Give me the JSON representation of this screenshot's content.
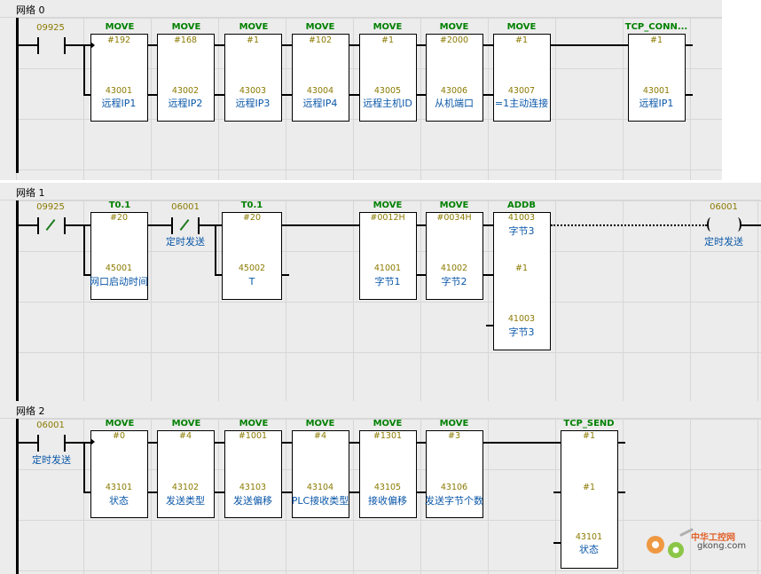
{
  "networks": [
    {
      "title": "网络 0"
    },
    {
      "title": "网络 1"
    },
    {
      "title": "网络 2"
    }
  ],
  "net0": {
    "contact": {
      "addr": "09925"
    },
    "blocks": [
      {
        "name": "MOVE",
        "in": "#192",
        "out": "43001",
        "label": "远程IP1"
      },
      {
        "name": "MOVE",
        "in": "#168",
        "out": "43002",
        "label": "远程IP2"
      },
      {
        "name": "MOVE",
        "in": "#1",
        "out": "43003",
        "label": "远程IP3"
      },
      {
        "name": "MOVE",
        "in": "#102",
        "out": "43004",
        "label": "远程IP4"
      },
      {
        "name": "MOVE",
        "in": "#1",
        "out": "43005",
        "label": "远程主机ID"
      },
      {
        "name": "MOVE",
        "in": "#2000",
        "out": "43006",
        "label": "从机端口"
      },
      {
        "name": "MOVE",
        "in": "#1",
        "out": "43007",
        "label": "=1主动连接"
      }
    ],
    "tcp_conn": {
      "name": "TCP_CONN...",
      "in": "#1",
      "out": "43001",
      "label": "远程IP1"
    }
  },
  "net1": {
    "contact1": {
      "addr": "09925"
    },
    "timer1": {
      "name": "T0.1",
      "in": "#20",
      "out": "45001",
      "label": "网口启动时间"
    },
    "contact2": {
      "addr": "06001",
      "label": "定时发送"
    },
    "timer2": {
      "name": "T0.1",
      "in": "#20",
      "out": "45002",
      "label": "T"
    },
    "move1": {
      "name": "MOVE",
      "in": "#0012H",
      "out": "41001",
      "label": "字节1"
    },
    "move2": {
      "name": "MOVE",
      "in": "#0034H",
      "out": "41002",
      "label": "字节2"
    },
    "addb": {
      "name": "ADDB",
      "in1": "41003",
      "in1_label": "字节3",
      "in2": "#1",
      "out": "41003",
      "out_label": "字节3"
    },
    "coil": {
      "addr": "06001",
      "label": "定时发送"
    }
  },
  "net2": {
    "contact": {
      "addr": "06001",
      "label": "定时发送"
    },
    "blocks": [
      {
        "name": "MOVE",
        "in": "#0",
        "out": "43101",
        "label": "状态"
      },
      {
        "name": "MOVE",
        "in": "#4",
        "out": "43102",
        "label": "发送类型"
      },
      {
        "name": "MOVE",
        "in": "#1001",
        "out": "43103",
        "label": "发送偏移"
      },
      {
        "name": "MOVE",
        "in": "#4",
        "out": "43104",
        "label": "PLC接收类型"
      },
      {
        "name": "MOVE",
        "in": "#1301",
        "out": "43105",
        "label": "接收偏移"
      },
      {
        "name": "MOVE",
        "in": "#3",
        "out": "43106",
        "label": "发送字节个数"
      }
    ],
    "tcp_send": {
      "name": "TCP_SEND",
      "in1": "#1",
      "in2": "#1",
      "out": "43101",
      "label": "状态"
    }
  },
  "watermark": {
    "line1": "中华工控网",
    "line2": "gkong.com",
    "colors": [
      "#f08a24",
      "#7bbf2a"
    ]
  }
}
